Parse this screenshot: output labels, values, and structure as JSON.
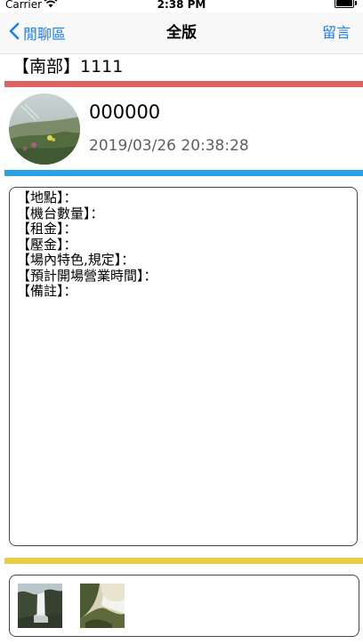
{
  "status_bar": {
    "carrier": "Carrier",
    "time": "2:38 PM"
  },
  "nav": {
    "back_label": "閒聊區",
    "title": "全版",
    "action_label": "留言",
    "accent_color": "#1a7ef5"
  },
  "post": {
    "title": "【南部】1111",
    "author_name": "000000",
    "timestamp": "2019/03/26 20:38:28",
    "content_lines": [
      "【地點】：",
      "【機台數量】：",
      "【租金】：",
      "【壓金】：",
      "【場內特色,規定】：",
      "【預計開場營業時間】：",
      "【備註】："
    ]
  },
  "divider_colors": {
    "red": "#e06261",
    "blue": "#2aa3e6",
    "yellow": "#e9cd44"
  },
  "icons": {
    "back": "chevron-left-icon",
    "wifi": "wifi-icon",
    "battery": "battery-icon"
  },
  "photos": [
    {
      "name": "waterfall-photo-1"
    },
    {
      "name": "waterfall-photo-2"
    }
  ]
}
